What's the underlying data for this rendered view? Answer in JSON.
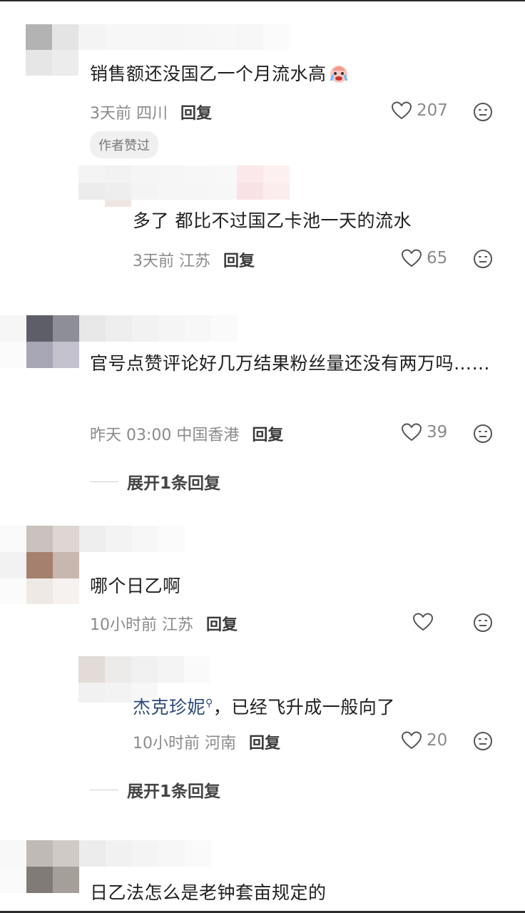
{
  "comments": [
    {
      "text": "销售额还没国乙一个月流水高",
      "time": "3天前",
      "location": "四川",
      "reply_label": "回复",
      "likes": "207",
      "badge": "作者赞过",
      "emoji_icon": "crying-face-emoji"
    },
    {
      "text": "多了 都比不过国乙卡池一天的流水",
      "time": "3天前",
      "location": "江苏",
      "reply_label": "回复",
      "likes": "65"
    },
    {
      "text": "官号点赞评论好几万结果粉丝量还没有两万吗……",
      "time": "昨天 03:00",
      "location": "中国香港",
      "reply_label": "回复",
      "likes": "39",
      "expand_label": "展开1条回复"
    },
    {
      "text": "哪个日乙啊",
      "time": "10小时前",
      "location": "江苏",
      "reply_label": "回复",
      "likes": ""
    },
    {
      "mention": "杰克珍妮",
      "text": "，已经飞升成一般向了",
      "time": "10小时前",
      "location": "河南",
      "reply_label": "回复",
      "likes": "20",
      "expand_label": "展开1条回复"
    },
    {
      "text": "日乙法怎么是老钟套亩规定的"
    }
  ]
}
